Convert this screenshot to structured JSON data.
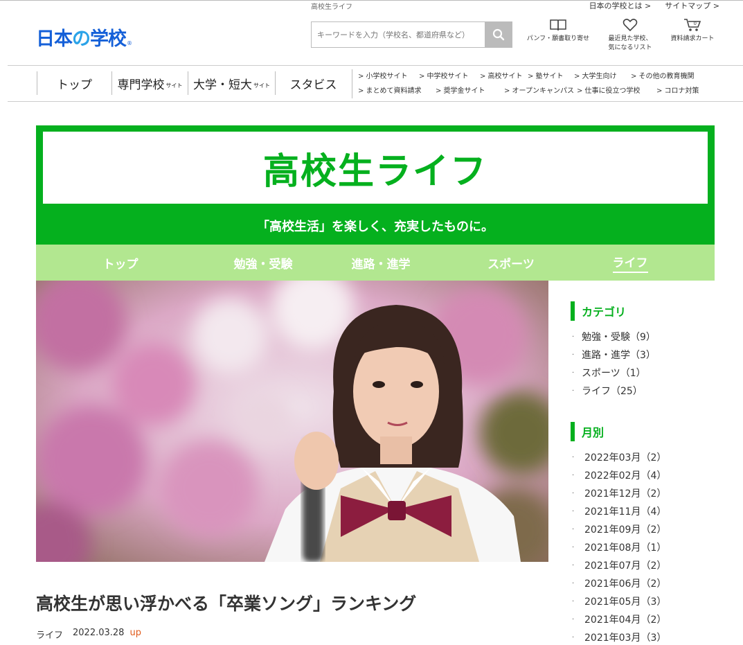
{
  "header": {
    "site_label": "高校生ライフ",
    "top_links": [
      "日本の学校とは >",
      "サイトマップ >"
    ],
    "logo_part1": "日本",
    "logo_part2": "の",
    "logo_part3": "学校",
    "logo_reg": "®",
    "search_placeholder": "キーワードを入力（学校名、都道府県など）",
    "icons": [
      {
        "label": "パンフ・願書取り寄せ",
        "icon": "book-icon"
      },
      {
        "label": "最近見た学校、\n気になるリスト",
        "icon": "heart-icon"
      },
      {
        "label": "資料請求カート",
        "icon": "cart-icon"
      }
    ],
    "cart_count": "0"
  },
  "global_nav": {
    "items": [
      {
        "label": "トップ",
        "suffix": ""
      },
      {
        "label": "専門学校",
        "suffix": "サイト"
      },
      {
        "label": "大学・短大",
        "suffix": "サイト"
      },
      {
        "label": "スタビス",
        "suffix": ""
      }
    ],
    "sublinks_row1": [
      "> 小学校サイト",
      "> 中学校サイト",
      "> 高校サイト",
      "> 塾サイト",
      "> 大学生向け",
      "> その他の教育機関"
    ],
    "sublinks_row2": [
      "> まとめて資料請求",
      "> 奨学金サイト",
      "> オープンキャンパス",
      "> 仕事に役立つ学校",
      "> コロナ対策"
    ]
  },
  "banner": {
    "title": "高校生ライフ",
    "subtitle": "「高校生活」を楽しく、充実したものに。"
  },
  "sub_nav": {
    "items": [
      "トップ",
      "勉強・受験",
      "進路・進学",
      "スポーツ",
      "ライフ"
    ],
    "active_index": 4
  },
  "article": {
    "title": "高校生が思い浮かべる「卒業ソング」ランキング",
    "category": "ライフ",
    "date": "2022.03.28",
    "badge": "up"
  },
  "sidebar": {
    "category_heading": "カテゴリ",
    "categories": [
      "勉強・受験（9）",
      "進路・進学（3）",
      "スポーツ（1）",
      "ライフ（25）"
    ],
    "monthly_heading": "月別",
    "months": [
      "2022年03月（2）",
      "2022年02月（4）",
      "2021年12月（2）",
      "2021年11月（4）",
      "2021年09月（2）",
      "2021年08月（1）",
      "2021年07月（2）",
      "2021年06月（2）",
      "2021年05月（3）",
      "2021年04月（2）",
      "2021年03月（3）"
    ]
  },
  "colors": {
    "brand_green": "#05b01e",
    "subnav_green": "#b2e790",
    "logo_blue": "#1560d8",
    "logo_light_blue": "#2ba3e8",
    "up_orange": "#e05a1a"
  }
}
